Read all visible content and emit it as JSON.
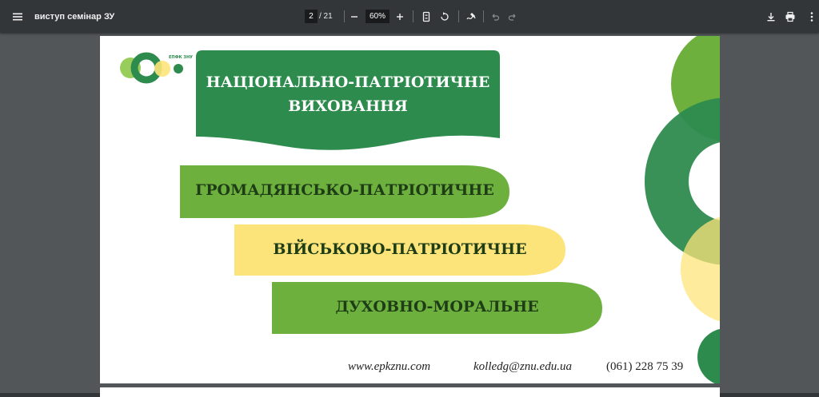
{
  "toolbar": {
    "title": "виступ семінар ЗУ",
    "current_page": "2",
    "total_pages": "/ 21",
    "zoom": "60%"
  },
  "slide": {
    "logo_text": "ЕПФК ЗНУ",
    "heading_line1": "НАЦІОНАЛЬНО-ПАТРІОТИЧНЕ",
    "heading_line2": "ВИХОВАННЯ",
    "item1": "ГРОМАДЯНСЬКО-ПАТРІОТИЧНЕ",
    "item2": "ВІЙСЬКОВО-ПАТРІОТИЧНЕ",
    "item3": "ДУХОВНО-МОРАЛЬНЕ",
    "website": "www.epkznu.com",
    "email": "kolledg@znu.edu.ua",
    "phone": "(061) 228 75 39"
  },
  "colors": {
    "dark_green": "#2e8b4e",
    "light_green": "#6db03e",
    "yellow": "#fde47a",
    "dark_text": "#1e3d16"
  }
}
